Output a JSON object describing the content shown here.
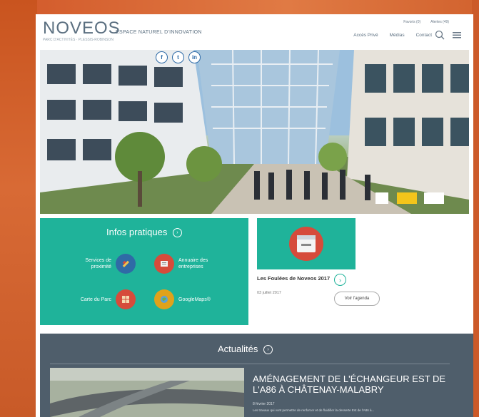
{
  "header": {
    "logo": "NOVEOS",
    "logo_sub": "PARC D'ACTIVITÉS · PLESSIS-ROBINSON",
    "tagline": "ESPACE NATUREL D'INNOVATION",
    "top_links": [
      "Favoris (0)",
      "Alertes (49)"
    ],
    "nav": [
      "Accès Privé",
      "Médias",
      "Contact"
    ]
  },
  "hero": {
    "social": [
      "f",
      "t",
      "in"
    ]
  },
  "infos": {
    "title": "Infos pratiques",
    "items": [
      {
        "label": "Services de proximité",
        "icon": "tools-icon",
        "color": "#2f6aa6"
      },
      {
        "label": "Annuaire des entreprises",
        "icon": "directory-icon",
        "color": "#d64b3b"
      },
      {
        "label": "Carte du Parc",
        "icon": "map-icon",
        "color": "#d64b3b"
      },
      {
        "label": "GoogleMaps®",
        "icon": "globe-icon",
        "color": "#e0a21b"
      }
    ]
  },
  "event": {
    "title": "Les Foulées de Noveos 2017",
    "date": "03 juillet 2017",
    "agenda_label": "Voir l'agenda"
  },
  "news": {
    "section_title": "Actualités",
    "headline": "AMÉNAGEMENT DE L'ÉCHANGEUR EST DE L'A86 À CHÂTENAY-MALABRY",
    "meta": "8 février 2017",
    "excerpt": "Les travaux qui vont permettre de renforcer et de fluidifier la desserte Est de l'A86 à..."
  },
  "colors": {
    "teal": "#1fb39a",
    "slate": "#4f5e6b",
    "frame": "#d9622e"
  }
}
